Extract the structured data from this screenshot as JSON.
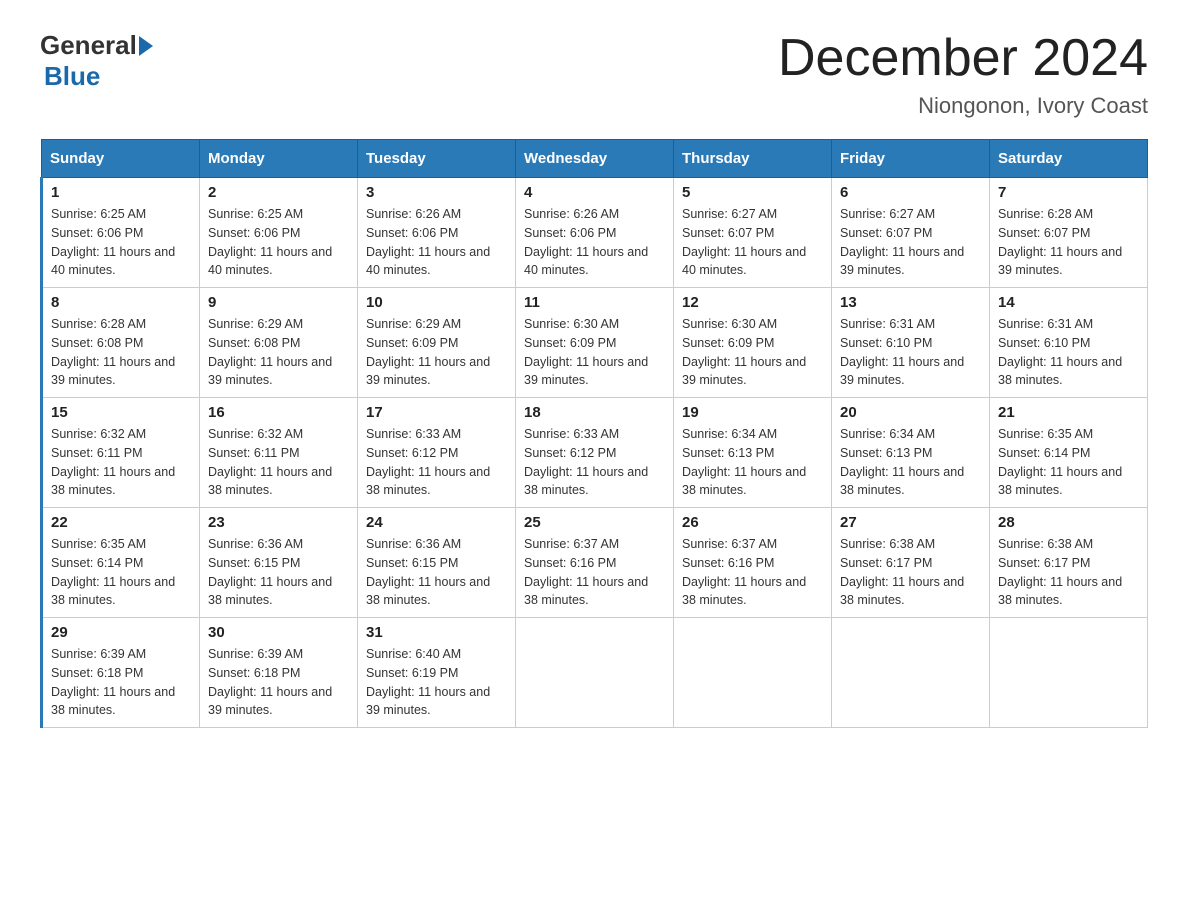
{
  "logo": {
    "general": "General",
    "blue": "Blue"
  },
  "header": {
    "title": "December 2024",
    "location": "Niongonon, Ivory Coast"
  },
  "weekdays": [
    "Sunday",
    "Monday",
    "Tuesday",
    "Wednesday",
    "Thursday",
    "Friday",
    "Saturday"
  ],
  "weeks": [
    [
      {
        "day": "1",
        "sunrise": "Sunrise: 6:25 AM",
        "sunset": "Sunset: 6:06 PM",
        "daylight": "Daylight: 11 hours and 40 minutes."
      },
      {
        "day": "2",
        "sunrise": "Sunrise: 6:25 AM",
        "sunset": "Sunset: 6:06 PM",
        "daylight": "Daylight: 11 hours and 40 minutes."
      },
      {
        "day": "3",
        "sunrise": "Sunrise: 6:26 AM",
        "sunset": "Sunset: 6:06 PM",
        "daylight": "Daylight: 11 hours and 40 minutes."
      },
      {
        "day": "4",
        "sunrise": "Sunrise: 6:26 AM",
        "sunset": "Sunset: 6:06 PM",
        "daylight": "Daylight: 11 hours and 40 minutes."
      },
      {
        "day": "5",
        "sunrise": "Sunrise: 6:27 AM",
        "sunset": "Sunset: 6:07 PM",
        "daylight": "Daylight: 11 hours and 40 minutes."
      },
      {
        "day": "6",
        "sunrise": "Sunrise: 6:27 AM",
        "sunset": "Sunset: 6:07 PM",
        "daylight": "Daylight: 11 hours and 39 minutes."
      },
      {
        "day": "7",
        "sunrise": "Sunrise: 6:28 AM",
        "sunset": "Sunset: 6:07 PM",
        "daylight": "Daylight: 11 hours and 39 minutes."
      }
    ],
    [
      {
        "day": "8",
        "sunrise": "Sunrise: 6:28 AM",
        "sunset": "Sunset: 6:08 PM",
        "daylight": "Daylight: 11 hours and 39 minutes."
      },
      {
        "day": "9",
        "sunrise": "Sunrise: 6:29 AM",
        "sunset": "Sunset: 6:08 PM",
        "daylight": "Daylight: 11 hours and 39 minutes."
      },
      {
        "day": "10",
        "sunrise": "Sunrise: 6:29 AM",
        "sunset": "Sunset: 6:09 PM",
        "daylight": "Daylight: 11 hours and 39 minutes."
      },
      {
        "day": "11",
        "sunrise": "Sunrise: 6:30 AM",
        "sunset": "Sunset: 6:09 PM",
        "daylight": "Daylight: 11 hours and 39 minutes."
      },
      {
        "day": "12",
        "sunrise": "Sunrise: 6:30 AM",
        "sunset": "Sunset: 6:09 PM",
        "daylight": "Daylight: 11 hours and 39 minutes."
      },
      {
        "day": "13",
        "sunrise": "Sunrise: 6:31 AM",
        "sunset": "Sunset: 6:10 PM",
        "daylight": "Daylight: 11 hours and 39 minutes."
      },
      {
        "day": "14",
        "sunrise": "Sunrise: 6:31 AM",
        "sunset": "Sunset: 6:10 PM",
        "daylight": "Daylight: 11 hours and 38 minutes."
      }
    ],
    [
      {
        "day": "15",
        "sunrise": "Sunrise: 6:32 AM",
        "sunset": "Sunset: 6:11 PM",
        "daylight": "Daylight: 11 hours and 38 minutes."
      },
      {
        "day": "16",
        "sunrise": "Sunrise: 6:32 AM",
        "sunset": "Sunset: 6:11 PM",
        "daylight": "Daylight: 11 hours and 38 minutes."
      },
      {
        "day": "17",
        "sunrise": "Sunrise: 6:33 AM",
        "sunset": "Sunset: 6:12 PM",
        "daylight": "Daylight: 11 hours and 38 minutes."
      },
      {
        "day": "18",
        "sunrise": "Sunrise: 6:33 AM",
        "sunset": "Sunset: 6:12 PM",
        "daylight": "Daylight: 11 hours and 38 minutes."
      },
      {
        "day": "19",
        "sunrise": "Sunrise: 6:34 AM",
        "sunset": "Sunset: 6:13 PM",
        "daylight": "Daylight: 11 hours and 38 minutes."
      },
      {
        "day": "20",
        "sunrise": "Sunrise: 6:34 AM",
        "sunset": "Sunset: 6:13 PM",
        "daylight": "Daylight: 11 hours and 38 minutes."
      },
      {
        "day": "21",
        "sunrise": "Sunrise: 6:35 AM",
        "sunset": "Sunset: 6:14 PM",
        "daylight": "Daylight: 11 hours and 38 minutes."
      }
    ],
    [
      {
        "day": "22",
        "sunrise": "Sunrise: 6:35 AM",
        "sunset": "Sunset: 6:14 PM",
        "daylight": "Daylight: 11 hours and 38 minutes."
      },
      {
        "day": "23",
        "sunrise": "Sunrise: 6:36 AM",
        "sunset": "Sunset: 6:15 PM",
        "daylight": "Daylight: 11 hours and 38 minutes."
      },
      {
        "day": "24",
        "sunrise": "Sunrise: 6:36 AM",
        "sunset": "Sunset: 6:15 PM",
        "daylight": "Daylight: 11 hours and 38 minutes."
      },
      {
        "day": "25",
        "sunrise": "Sunrise: 6:37 AM",
        "sunset": "Sunset: 6:16 PM",
        "daylight": "Daylight: 11 hours and 38 minutes."
      },
      {
        "day": "26",
        "sunrise": "Sunrise: 6:37 AM",
        "sunset": "Sunset: 6:16 PM",
        "daylight": "Daylight: 11 hours and 38 minutes."
      },
      {
        "day": "27",
        "sunrise": "Sunrise: 6:38 AM",
        "sunset": "Sunset: 6:17 PM",
        "daylight": "Daylight: 11 hours and 38 minutes."
      },
      {
        "day": "28",
        "sunrise": "Sunrise: 6:38 AM",
        "sunset": "Sunset: 6:17 PM",
        "daylight": "Daylight: 11 hours and 38 minutes."
      }
    ],
    [
      {
        "day": "29",
        "sunrise": "Sunrise: 6:39 AM",
        "sunset": "Sunset: 6:18 PM",
        "daylight": "Daylight: 11 hours and 38 minutes."
      },
      {
        "day": "30",
        "sunrise": "Sunrise: 6:39 AM",
        "sunset": "Sunset: 6:18 PM",
        "daylight": "Daylight: 11 hours and 39 minutes."
      },
      {
        "day": "31",
        "sunrise": "Sunrise: 6:40 AM",
        "sunset": "Sunset: 6:19 PM",
        "daylight": "Daylight: 11 hours and 39 minutes."
      },
      null,
      null,
      null,
      null
    ]
  ]
}
